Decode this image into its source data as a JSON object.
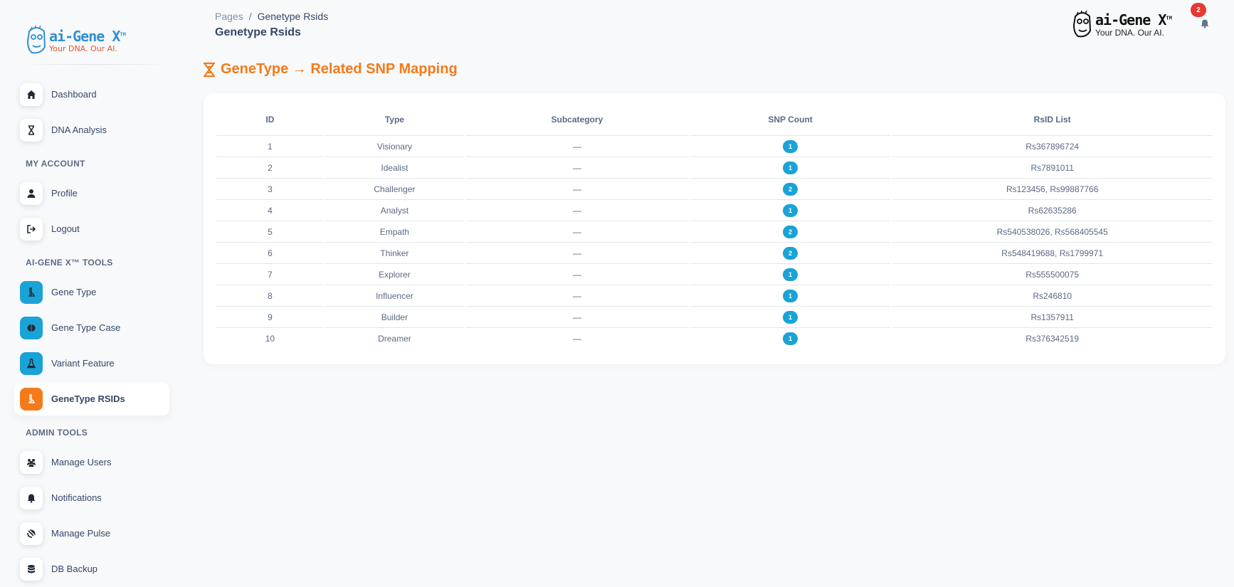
{
  "sidebar": {
    "brand": {
      "name": "ai-Gene X",
      "tm": "TM",
      "tagline": "Your DNA. Our AI."
    },
    "items_main": [
      {
        "label": "Dashboard",
        "icon": "home-icon"
      },
      {
        "label": "DNA Analysis",
        "icon": "dna-icon"
      }
    ],
    "section_account": "MY ACCOUNT",
    "items_account": [
      {
        "label": "Profile",
        "icon": "user-icon"
      },
      {
        "label": "Logout",
        "icon": "logout-icon"
      }
    ],
    "section_tools": "AI-GENE X™ TOOLS",
    "items_tools": [
      {
        "label": "Gene Type",
        "icon": "microscope-icon"
      },
      {
        "label": "Gene Type Case",
        "icon": "brain-icon"
      },
      {
        "label": "Variant Feature",
        "icon": "flask-icon"
      },
      {
        "label": "GeneType RSIDs",
        "icon": "microscope-icon",
        "active": true
      }
    ],
    "section_admin": "ADMIN TOOLS",
    "items_admin": [
      {
        "label": "Manage Users",
        "icon": "users-icon"
      },
      {
        "label": "Notifications",
        "icon": "bell-icon"
      },
      {
        "label": "Manage Pulse",
        "icon": "satellite-icon"
      },
      {
        "label": "DB Backup",
        "icon": "database-icon"
      }
    ]
  },
  "header": {
    "breadcrumb_root": "Pages",
    "breadcrumb_sep": "/",
    "breadcrumb_current": "Genetype Rsids",
    "title": "Genetype Rsids",
    "logo": {
      "name": "ai-Gene X",
      "tm": "TM",
      "tagline": "Your DNA. Our AI."
    },
    "notification_count": "2"
  },
  "main": {
    "heading": "GeneType → Related SNP Mapping",
    "table": {
      "columns": [
        "ID",
        "Type",
        "Subcategory",
        "SNP Count",
        "RsID List"
      ],
      "rows": [
        {
          "id": "1",
          "type": "Visionary",
          "subcategory": "—",
          "snp_count": "1",
          "rsids": "Rs367896724"
        },
        {
          "id": "2",
          "type": "Idealist",
          "subcategory": "—",
          "snp_count": "1",
          "rsids": "Rs7891011"
        },
        {
          "id": "3",
          "type": "Challenger",
          "subcategory": "—",
          "snp_count": "2",
          "rsids": "Rs123456, Rs99887766"
        },
        {
          "id": "4",
          "type": "Analyst",
          "subcategory": "—",
          "snp_count": "1",
          "rsids": "Rs62635286"
        },
        {
          "id": "5",
          "type": "Empath",
          "subcategory": "—",
          "snp_count": "2",
          "rsids": "Rs540538026, Rs568405545"
        },
        {
          "id": "6",
          "type": "Thinker",
          "subcategory": "—",
          "snp_count": "2",
          "rsids": "Rs548419688, Rs1799971"
        },
        {
          "id": "7",
          "type": "Explorer",
          "subcategory": "—",
          "snp_count": "1",
          "rsids": "Rs555500075"
        },
        {
          "id": "8",
          "type": "Influencer",
          "subcategory": "—",
          "snp_count": "1",
          "rsids": "Rs246810"
        },
        {
          "id": "9",
          "type": "Builder",
          "subcategory": "—",
          "snp_count": "1",
          "rsids": "Rs1357911"
        },
        {
          "id": "10",
          "type": "Dreamer",
          "subcategory": "—",
          "snp_count": "1",
          "rsids": "Rs376342519"
        }
      ]
    }
  },
  "colors": {
    "accent": "#f57a19",
    "badge": "#1aa3d6",
    "notification": "#e53935"
  }
}
